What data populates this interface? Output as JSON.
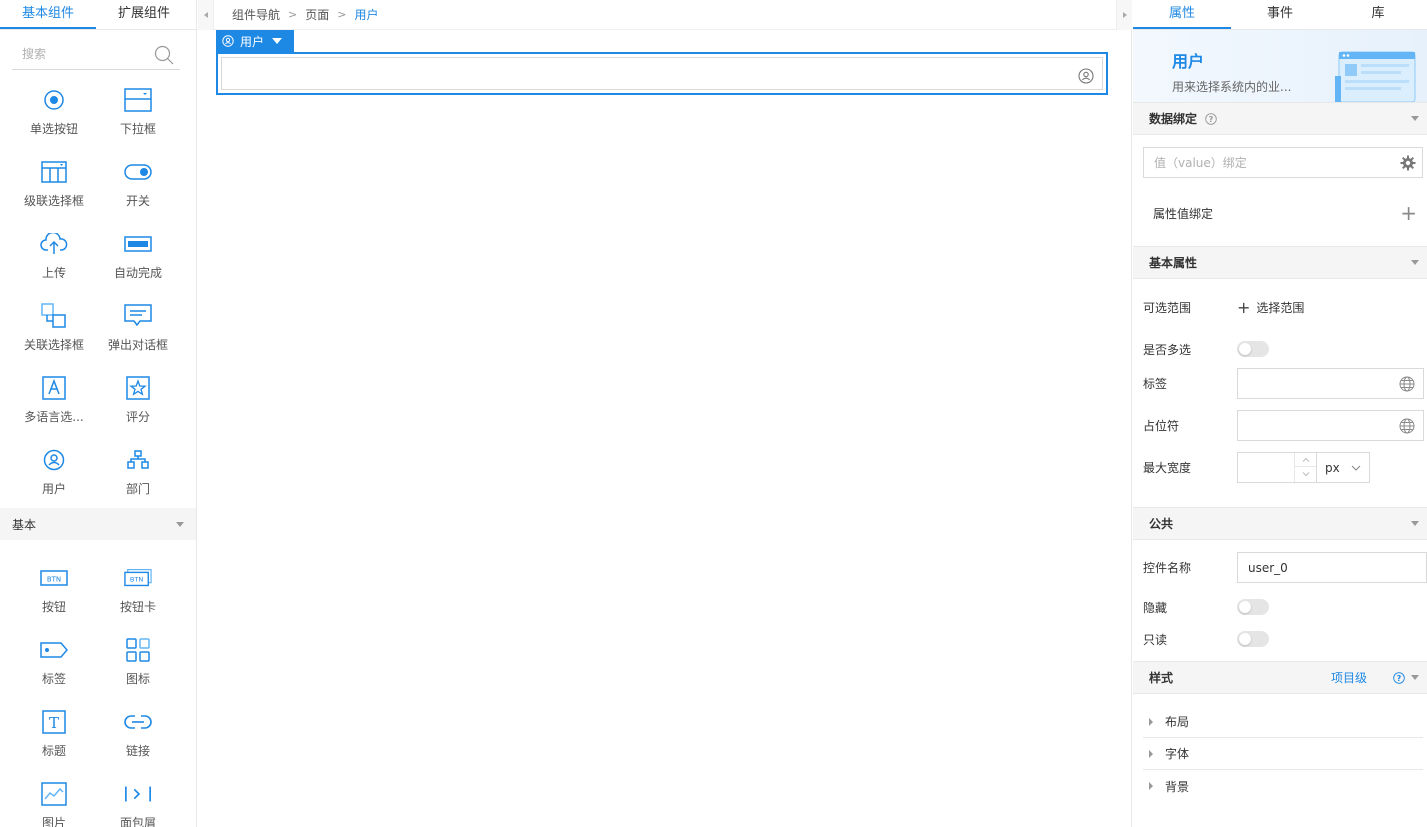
{
  "left": {
    "tabs": [
      "基本组件",
      "扩展组件"
    ],
    "search_placeholder": "搜索",
    "group1": [
      {
        "label": "单选按钮",
        "icon": "radio-icon"
      },
      {
        "label": "下拉框",
        "icon": "dropdown-icon"
      },
      {
        "label": "级联选择框",
        "icon": "cascader-icon"
      },
      {
        "label": "开关",
        "icon": "switch-icon"
      },
      {
        "label": "上传",
        "icon": "upload-icon"
      },
      {
        "label": "自动完成",
        "icon": "autocomplete-icon"
      },
      {
        "label": "关联选择框",
        "icon": "relation-select-icon"
      },
      {
        "label": "弹出对话框",
        "icon": "popup-dialog-icon"
      },
      {
        "label": "多语言选...",
        "icon": "multilang-icon"
      },
      {
        "label": "评分",
        "icon": "rate-icon"
      },
      {
        "label": "用户",
        "icon": "user-icon"
      },
      {
        "label": "部门",
        "icon": "department-icon"
      }
    ],
    "section_basic": "基本",
    "group2": [
      {
        "label": "按钮",
        "icon": "button-icon",
        "text": "BTN"
      },
      {
        "label": "按钮卡",
        "icon": "button-card-icon",
        "text": "BTN"
      },
      {
        "label": "标签",
        "icon": "tag-icon"
      },
      {
        "label": "图标",
        "icon": "grid-icon"
      },
      {
        "label": "标题",
        "icon": "title-icon",
        "text": "T"
      },
      {
        "label": "链接",
        "icon": "link-icon"
      },
      {
        "label": "图片",
        "icon": "image-icon"
      },
      {
        "label": "面包屑",
        "icon": "breadcrumb-icon"
      }
    ]
  },
  "breadcrumb": {
    "items": [
      "组件导航",
      "页面",
      "用户"
    ]
  },
  "canvas": {
    "selected_tag": "用户"
  },
  "right": {
    "tabs": [
      "属性",
      "事件",
      "库"
    ],
    "banner_title": "用户",
    "banner_desc": "用来选择系统内的业...",
    "data_binding": {
      "title": "数据绑定",
      "value_placeholder": "值（value）绑定",
      "attr_binding": "属性值绑定"
    },
    "basic": {
      "title": "基本属性",
      "range_label": "可选范围",
      "range_button": "选择范围",
      "multi_label": "是否多选",
      "label_label": "标签",
      "placeholder_label": "占位符",
      "maxwidth_label": "最大宽度",
      "unit": "px"
    },
    "common": {
      "title": "公共",
      "name_label": "控件名称",
      "name_value": "user_0",
      "hidden_label": "隐藏",
      "readonly_label": "只读"
    },
    "style": {
      "title": "样式",
      "level": "项目级",
      "items": [
        "布局",
        "字体",
        "背景"
      ]
    }
  },
  "colors": {
    "accent": "#1e88e5"
  }
}
